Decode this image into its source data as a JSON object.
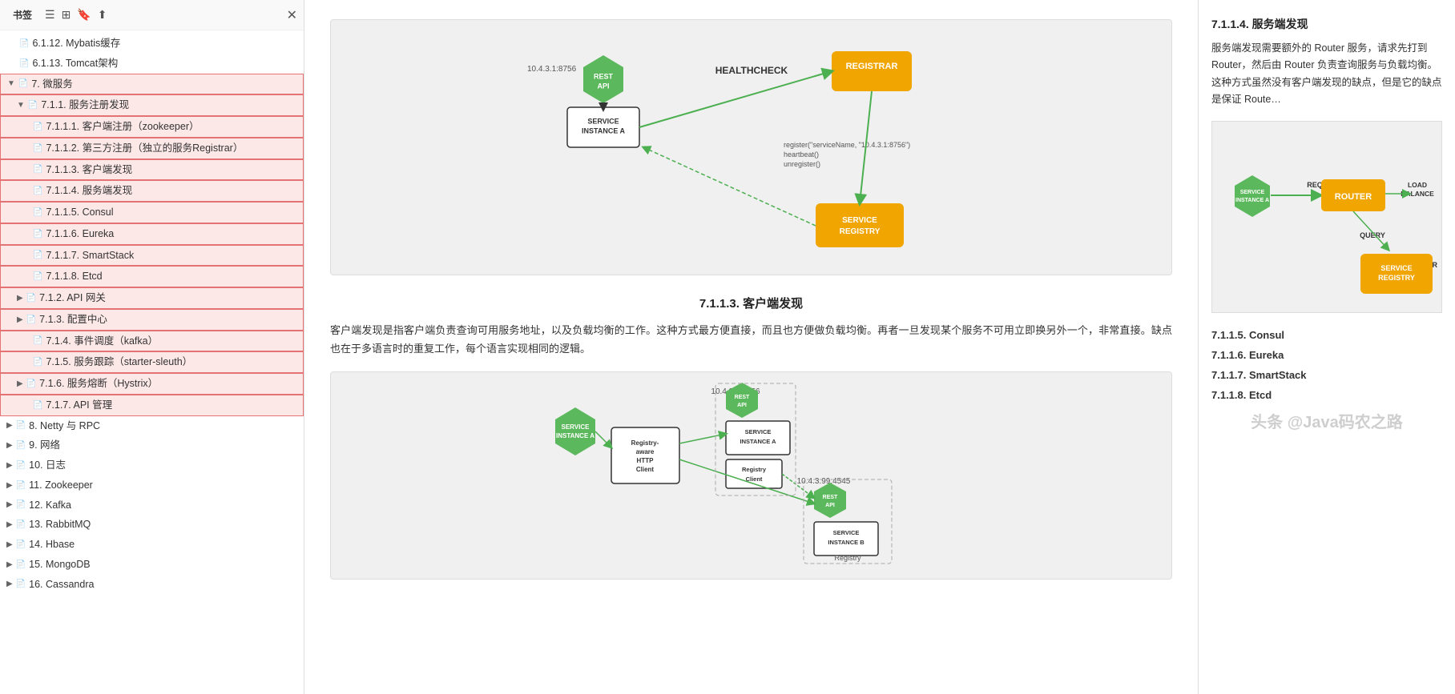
{
  "sidebar": {
    "label": "书签",
    "items": [
      {
        "id": "6.1.12",
        "label": "6.1.12. Mybatis缓存",
        "indent": 1,
        "hasArrow": false,
        "highlighted": false
      },
      {
        "id": "6.1.13",
        "label": "6.1.13. Tomcat架构",
        "indent": 1,
        "hasArrow": false,
        "highlighted": false
      },
      {
        "id": "7",
        "label": "7. 微服务",
        "indent": 0,
        "hasArrow": true,
        "expanded": true,
        "highlighted": true
      },
      {
        "id": "7.1.1",
        "label": "7.1.1. 服务注册发现",
        "indent": 1,
        "hasArrow": true,
        "expanded": true,
        "highlighted": true
      },
      {
        "id": "7.1.1.1",
        "label": "7.1.1.1. 客户端注册（zookeeper）",
        "indent": 2,
        "hasArrow": false,
        "highlighted": true
      },
      {
        "id": "7.1.1.2",
        "label": "7.1.1.2. 第三方注册（独立的服务Registrar）",
        "indent": 2,
        "hasArrow": false,
        "highlighted": true
      },
      {
        "id": "7.1.1.3",
        "label": "7.1.1.3. 客户端发现",
        "indent": 2,
        "hasArrow": false,
        "highlighted": true
      },
      {
        "id": "7.1.1.4",
        "label": "7.1.1.4. 服务端发现",
        "indent": 2,
        "hasArrow": false,
        "highlighted": true
      },
      {
        "id": "7.1.1.5",
        "label": "7.1.1.5. Consul",
        "indent": 2,
        "hasArrow": false,
        "highlighted": true
      },
      {
        "id": "7.1.1.6",
        "label": "7.1.1.6. Eureka",
        "indent": 2,
        "hasArrow": false,
        "highlighted": true
      },
      {
        "id": "7.1.1.7",
        "label": "7.1.1.7. SmartStack",
        "indent": 2,
        "hasArrow": false,
        "highlighted": true
      },
      {
        "id": "7.1.1.8",
        "label": "7.1.1.8. Etcd",
        "indent": 2,
        "hasArrow": false,
        "highlighted": true
      },
      {
        "id": "7.1.2",
        "label": "7.1.2. API 网关",
        "indent": 1,
        "hasArrow": true,
        "expanded": false,
        "highlighted": true
      },
      {
        "id": "7.1.3",
        "label": "7.1.3. 配置中心",
        "indent": 1,
        "hasArrow": true,
        "expanded": false,
        "highlighted": true
      },
      {
        "id": "7.1.4",
        "label": "7.1.4. 事件调度（kafka）",
        "indent": 2,
        "hasArrow": false,
        "highlighted": true
      },
      {
        "id": "7.1.5",
        "label": "7.1.5. 服务跟踪（starter-sleuth）",
        "indent": 2,
        "hasArrow": false,
        "highlighted": true
      },
      {
        "id": "7.1.6",
        "label": "7.1.6. 服务熔断（Hystrix）",
        "indent": 1,
        "hasArrow": true,
        "expanded": false,
        "highlighted": true
      },
      {
        "id": "7.1.7",
        "label": "7.1.7. API 管理",
        "indent": 2,
        "hasArrow": false,
        "highlighted": true
      },
      {
        "id": "8",
        "label": "8. Netty 与 RPC",
        "indent": 0,
        "hasArrow": true,
        "expanded": false,
        "highlighted": false
      },
      {
        "id": "9",
        "label": "9. 网络",
        "indent": 0,
        "hasArrow": true,
        "expanded": false,
        "highlighted": false
      },
      {
        "id": "10",
        "label": "10. 日志",
        "indent": 0,
        "hasArrow": true,
        "expanded": false,
        "highlighted": false
      },
      {
        "id": "11",
        "label": "11. Zookeeper",
        "indent": 0,
        "hasArrow": true,
        "expanded": false,
        "highlighted": false
      },
      {
        "id": "12",
        "label": "12. Kafka",
        "indent": 0,
        "hasArrow": true,
        "expanded": false,
        "highlighted": false
      },
      {
        "id": "13",
        "label": "13. RabbitMQ",
        "indent": 0,
        "hasArrow": true,
        "expanded": false,
        "highlighted": false
      },
      {
        "id": "14",
        "label": "14. Hbase",
        "indent": 0,
        "hasArrow": true,
        "expanded": false,
        "highlighted": false
      },
      {
        "id": "15",
        "label": "15. MongoDB",
        "indent": 0,
        "hasArrow": true,
        "expanded": false,
        "highlighted": false
      },
      {
        "id": "16",
        "label": "16. Cassandra",
        "indent": 0,
        "hasArrow": true,
        "expanded": false,
        "highlighted": false
      }
    ],
    "icons": [
      "bookmark-list-icon",
      "add-bookmark-icon",
      "save-icon",
      "share-icon"
    ]
  },
  "main": {
    "section_7113": {
      "title": "7.1.1.3.    客户端发现",
      "paragraph": "客户端发现是指客户端负责查询可用服务地址，以及负载均衡的工作。这种方式最方便直接，而且也方便做负载均衡。再者一旦发现某个服务不可用立即换另外一个，非常直接。缺点也在于多语言时的重复工作，每个语言实现相同的逻辑。"
    },
    "section_7114": {
      "title": "7.1.1.4.    服务端发现",
      "paragraph": "服务端发现需要额外的 Router 服务，请求先打到 Router，然后由 Router 负责查询服务与负载均衡。这种方式虽然没有客户端发现的缺点，但是它的缺点是保证 Router 的可用性。"
    },
    "diagram1": {
      "ip_label": "10.4.3.1:8756",
      "service_instance_a": "SERVICE\nINSTANCE A",
      "rest_api": "REST\nAPI",
      "healthcheck": "HEALTHCHECK",
      "registrar": "REGISTRAR",
      "service_registry": "SERVICE\nREGISTRY",
      "register_text": "register(\"serviceName, \"10.4.3.1:8756\")\nheartbeat()\nunregister()"
    },
    "diagram2": {
      "ip1": "10.4.3.1:8756",
      "ip2": "10.4.3.99:4545",
      "service_instance_a_1": "SERVICE\nINSTANCE A",
      "rest_api_1": "REST\nAPI",
      "registry_aware": "Registry-\naware\nHTTP\nClient",
      "service_instance_a_2": "SERVICE\nINSTANCE A",
      "rest_api_2": "REST\nAPI",
      "registry_client": "Registry\nClient",
      "rest_api_3": "REST\nAPI",
      "service_instance_b": "SERVICE\nINSTANCE B",
      "registry_bottom": "Registry"
    }
  },
  "right": {
    "section_7114_title": "7.1.1.4.    服务端发现",
    "paragraph": "服务端发现需要额外的 Router 服务，请求先打到 Router，然后由 Router 负责查询服务与负载均衡。这种方式虽然没有客户端发现的缺点，但是它的缺点是保证 Route…",
    "diagram": {
      "service_instance_a": "SERVICE\nINSTANCE A",
      "request": "REQUEST",
      "router": "ROUTER",
      "load_balance": "LOAD\nBALANCE",
      "query": "QUERY",
      "register": "REGISTER",
      "service_registry": "SERVICE\nREGISTRY"
    },
    "subsections": [
      {
        "id": "7.1.1.5",
        "title": "7.1.1.5.",
        "label": "Consul"
      },
      {
        "id": "7.1.1.6",
        "title": "7.1.1.6.",
        "label": "Eureka"
      },
      {
        "id": "7.1.1.7",
        "title": "7.1.1.7.",
        "label": "SmartStack"
      },
      {
        "id": "7.1.1.8",
        "title": "7.1.1.8.",
        "label": "Etcd"
      }
    ],
    "watermark": "头条 @Java码农之路"
  }
}
